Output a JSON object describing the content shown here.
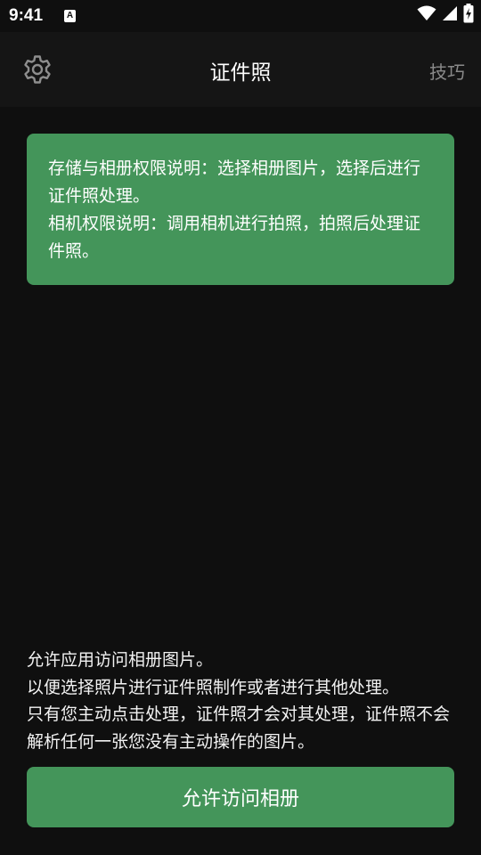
{
  "status_bar": {
    "time": "9:41",
    "notification_glyph": "A",
    "icons": [
      "wifi-icon",
      "signal-icon",
      "battery-charging-icon"
    ]
  },
  "toolbar": {
    "settings_icon": "gear-icon",
    "title": "证件照",
    "tips_label": "技巧"
  },
  "permission_card": {
    "storage_text": "存储与相册权限说明：选择相册图片，选择后进行证件照处理。",
    "camera_text": "相机权限说明：调用相机进行拍照，拍照后处理证件照。"
  },
  "explanation": {
    "line1": "允许应用访问相册图片。",
    "line2": "以便选择照片进行证件照制作或者进行其他处理。",
    "line3": "只有您主动点击处理，证件照才会对其处理，证件照不会解析任何一张您没有主动操作的图片。"
  },
  "allow_button": {
    "label": "允许访问相册"
  },
  "colors": {
    "background": "#0f0f0f",
    "toolbar": "#151515",
    "accent_green": "#44955a",
    "muted_text": "#8a8a8a"
  }
}
